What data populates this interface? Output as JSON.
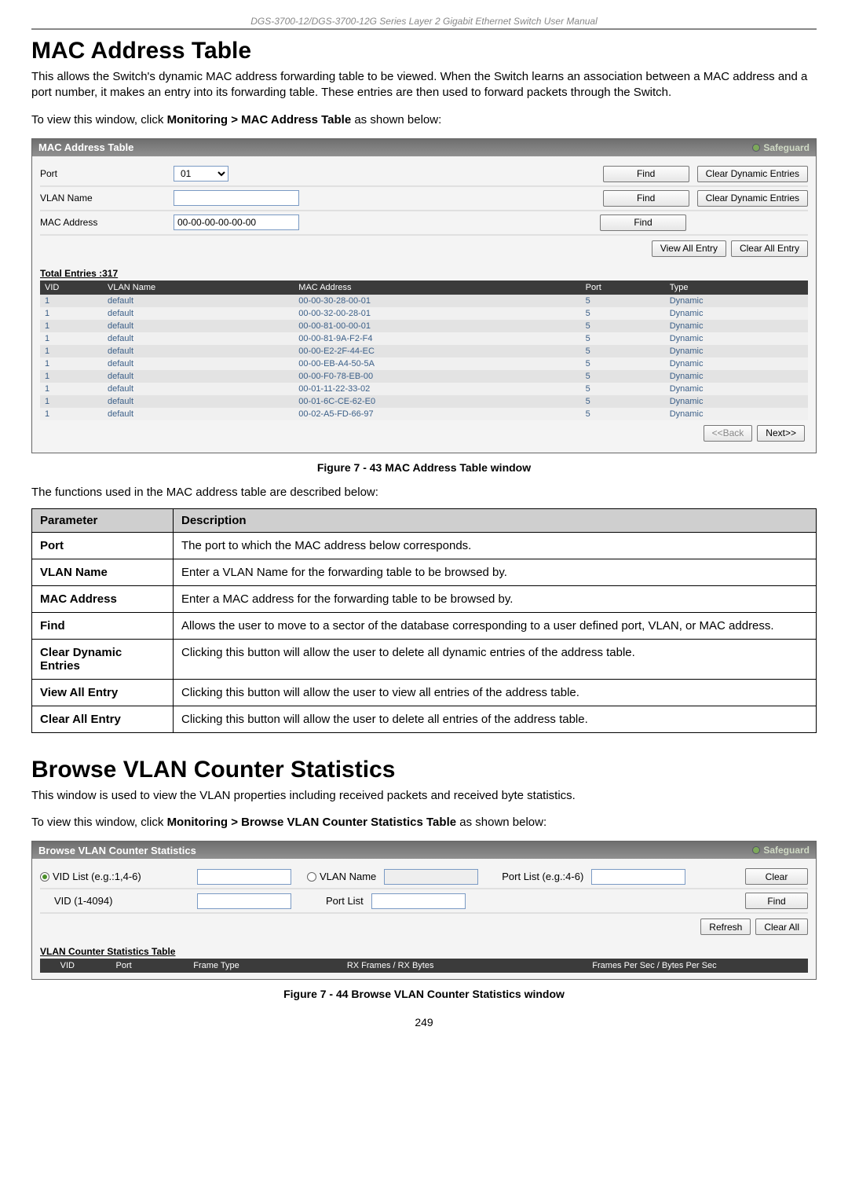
{
  "doc_header": "DGS-3700-12/DGS-3700-12G Series Layer 2 Gigabit Ethernet Switch User Manual",
  "page_number": "249",
  "section1_title": "MAC Address Table",
  "section1_intro": "This allows the Switch's dynamic MAC address forwarding table to be viewed. When the Switch learns an association between a MAC address and a port number, it makes an entry into its forwarding table. These entries are then used to forward packets through the Switch.",
  "section1_instruction_prefix": "To view this window, click ",
  "section1_instruction_bold": "Monitoring > MAC Address Table",
  "section1_instruction_suffix": " as shown below:",
  "panel1": {
    "title": "MAC Address Table",
    "safeguard": "Safeguard",
    "port_label": "Port",
    "port_value": "01",
    "vlan_label": "VLAN Name",
    "vlan_value": "",
    "mac_label": "MAC Address",
    "mac_value": "00-00-00-00-00-00",
    "find_label": "Find",
    "clear_dynamic_label": "Clear Dynamic Entries",
    "view_all_label": "View All Entry",
    "clear_all_label": "Clear All Entry",
    "total_entries_label": "Total Entries :317",
    "columns": {
      "vid": "VID",
      "vlan": "VLAN Name",
      "mac": "MAC Address",
      "port": "Port",
      "type": "Type"
    },
    "rows": [
      {
        "vid": "1",
        "vlan": "default",
        "mac": "00-00-30-28-00-01",
        "port": "5",
        "type": "Dynamic"
      },
      {
        "vid": "1",
        "vlan": "default",
        "mac": "00-00-32-00-28-01",
        "port": "5",
        "type": "Dynamic"
      },
      {
        "vid": "1",
        "vlan": "default",
        "mac": "00-00-81-00-00-01",
        "port": "5",
        "type": "Dynamic"
      },
      {
        "vid": "1",
        "vlan": "default",
        "mac": "00-00-81-9A-F2-F4",
        "port": "5",
        "type": "Dynamic"
      },
      {
        "vid": "1",
        "vlan": "default",
        "mac": "00-00-E2-2F-44-EC",
        "port": "5",
        "type": "Dynamic"
      },
      {
        "vid": "1",
        "vlan": "default",
        "mac": "00-00-EB-A4-50-5A",
        "port": "5",
        "type": "Dynamic"
      },
      {
        "vid": "1",
        "vlan": "default",
        "mac": "00-00-F0-78-EB-00",
        "port": "5",
        "type": "Dynamic"
      },
      {
        "vid": "1",
        "vlan": "default",
        "mac": "00-01-11-22-33-02",
        "port": "5",
        "type": "Dynamic"
      },
      {
        "vid": "1",
        "vlan": "default",
        "mac": "00-01-6C-CE-62-E0",
        "port": "5",
        "type": "Dynamic"
      },
      {
        "vid": "1",
        "vlan": "default",
        "mac": "00-02-A5-FD-66-97",
        "port": "5",
        "type": "Dynamic"
      }
    ],
    "back_label": "<<Back",
    "next_label": "Next>>"
  },
  "figure1_caption": "Figure 7 - 43 MAC Address Table window",
  "table_intro": "The functions used in the MAC address table are described below:",
  "param_table": {
    "h1": "Parameter",
    "h2": "Description",
    "rows": [
      {
        "name": "Port",
        "desc": "The port to which the MAC address below corresponds."
      },
      {
        "name": "VLAN Name",
        "desc": "Enter a VLAN Name for the forwarding table to be browsed by."
      },
      {
        "name": "MAC Address",
        "desc": "Enter a MAC address for the forwarding table to be browsed by."
      },
      {
        "name": "Find",
        "desc": "Allows the user to move to a sector of the database corresponding to a user defined port, VLAN, or MAC address."
      },
      {
        "name": "Clear Dynamic Entries",
        "desc": "Clicking this button will allow the user to delete all dynamic entries of the address table."
      },
      {
        "name": "View All Entry",
        "desc": "Clicking this button will allow the user to view all entries of the address table."
      },
      {
        "name": "Clear All Entry",
        "desc": "Clicking this button will allow the user to delete all entries of the address table."
      }
    ]
  },
  "section2_title": "Browse VLAN Counter Statistics",
  "section2_intro": "This window is used to view the VLAN properties including received packets and received byte statistics.",
  "section2_instruction_prefix": "To view this window, click ",
  "section2_instruction_bold": "Monitoring > Browse VLAN Counter Statistics Table",
  "section2_instruction_suffix": " as shown below:",
  "panel2": {
    "title": "Browse VLAN Counter Statistics",
    "safeguard": "Safeguard",
    "radio_vid_label": "VID List (e.g.:1,4-6)",
    "radio_vlan_label": "VLAN Name",
    "port_list_label": "Port List (e.g.:4-6)",
    "clear_label": "Clear",
    "vid_label": "VID (1-4094)",
    "port_list_label2": "Port List",
    "find_label": "Find",
    "refresh_label": "Refresh",
    "clear_all_label": "Clear All",
    "stats_title": "VLAN Counter Statistics Table",
    "columns": {
      "vid": "VID",
      "port": "Port",
      "frame": "Frame Type",
      "rx": "RX Frames / RX Bytes",
      "fps": "Frames Per Sec / Bytes Per Sec"
    }
  },
  "figure2_caption": "Figure 7 - 44 Browse VLAN Counter Statistics window"
}
